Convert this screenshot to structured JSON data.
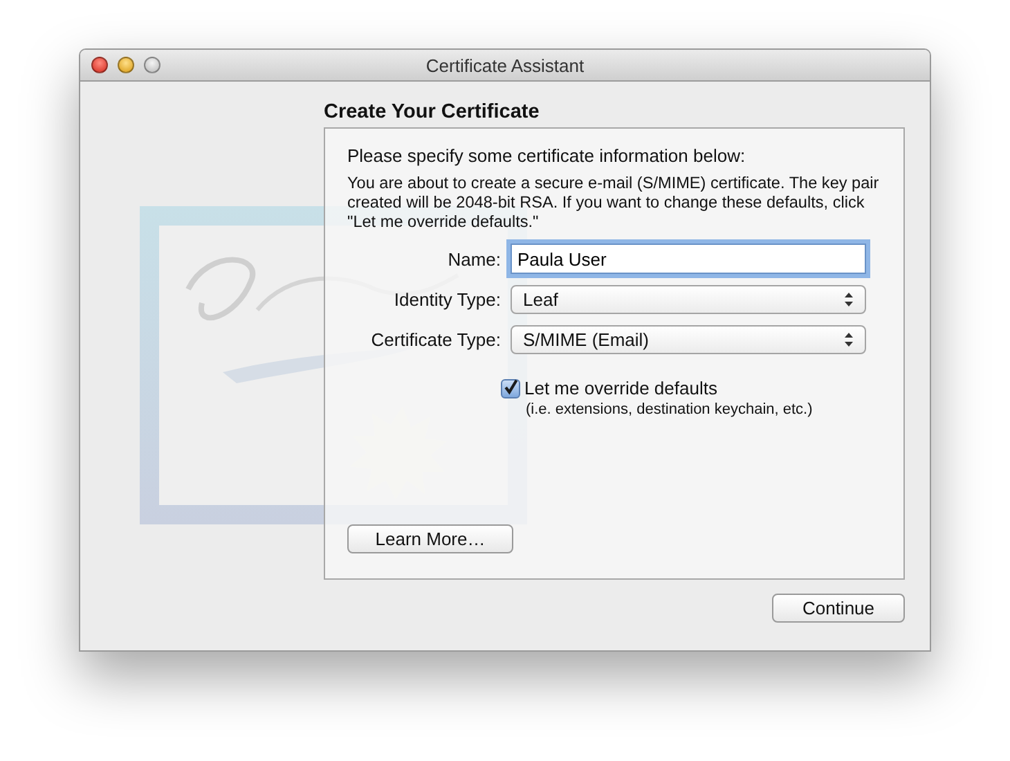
{
  "window": {
    "title": "Certificate Assistant"
  },
  "heading": "Create Your Certificate",
  "panel": {
    "prompt": "Please specify some certificate information below:",
    "description": "You are about to create a secure e-mail (S/MIME) certificate. The key pair created will be 2048-bit RSA. If you want to change these defaults, click \"Let me override defaults.\"",
    "fields": [
      {
        "kind": "text",
        "label": "Name:",
        "value": "Paula User",
        "focused": true
      },
      {
        "kind": "popup",
        "label": "Identity Type:",
        "value": "Leaf"
      },
      {
        "kind": "popup",
        "label": "Certificate Type:",
        "value": "S/MIME (Email)"
      }
    ],
    "override": {
      "label": "Let me override defaults",
      "note": "(i.e. extensions, destination keychain, etc.)",
      "checked": true
    },
    "learn_more": "Learn More…"
  },
  "buttons": [
    {
      "label": "Continue"
    }
  ]
}
